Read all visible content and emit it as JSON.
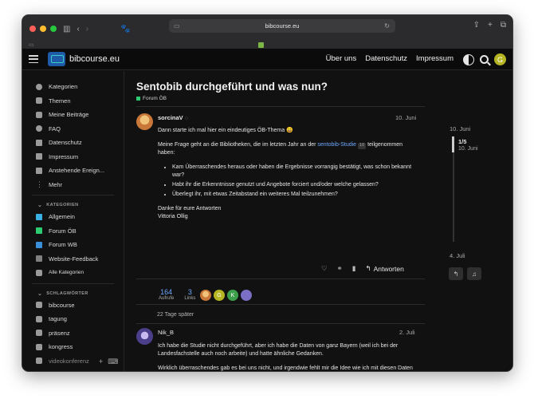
{
  "browser": {
    "url": "bibcourse.eu"
  },
  "site": {
    "name": "bibcourse.eu",
    "nav": [
      "Über uns",
      "Datenschutz",
      "Impressum"
    ],
    "user_initial": "G"
  },
  "sidebar": {
    "items": [
      "Kategorien",
      "Themen",
      "Meine Beiträge",
      "FAQ",
      "Datenschutz",
      "Impressum",
      "Anstehende Ereign...",
      "Mehr"
    ],
    "categories_header": "KATEGORIEN",
    "categories": [
      {
        "label": "Allgemein",
        "color": "#3ab0e2"
      },
      {
        "label": "Forum ÖB",
        "color": "#2ecc71"
      },
      {
        "label": "Forum WB",
        "color": "#3a8fd9"
      },
      {
        "label": "Website-Feedback",
        "color": "#808080"
      }
    ],
    "all_categories": "Alle Kategorien",
    "tags_header": "SCHLAGWÖRTER",
    "tags": [
      "bibcourse",
      "tagung",
      "präsenz",
      "kongress",
      "videokonferenz"
    ]
  },
  "topic": {
    "title": "Sentobib durchgeführt und was nun?",
    "category": "Forum ÖB"
  },
  "post1": {
    "author": "sorcinaV",
    "date": "10. Juni",
    "greeting": "Dann starte ich mal hier ein eindeutiges ÖB-Thema 😀",
    "para_a": "Meine Frage geht an die Bibliotheken, die im letzten Jahr an der ",
    "link": "sentobib-Studie",
    "link_count": "10",
    "para_b": " teilgenommen haben:",
    "bullets": [
      "Kam Überraschendes heraus oder haben die Ergebnisse vorrangig bestätigt, was schon bekannt war?",
      "Habt ihr die Erkenntnisse genutzt und Angebote forciert und/oder welche gelassen?",
      "Überlegt ihr, mit etwas Zeitabstand ein weiteres Mal teilzunehmen?"
    ],
    "thanks": "Danke für eure Antworten",
    "signature": "Vittoria Ollig",
    "reply_label": "Antworten",
    "views": "164",
    "views_label": "Aufrufe",
    "links": "3",
    "links_label": "Links",
    "participants": [
      "G",
      "K"
    ]
  },
  "gap": "22 Tage später",
  "post2": {
    "author": "Nik_B",
    "date": "2. Juli",
    "p1": "Ich habe die Studie nicht durchgeführt, aber ich habe die Daten von ganz Bayern (weil ich bei der Landesfachstelle auch noch arbeite) und hatte ähnliche Gedanken.",
    "p2": "Wirklich überraschendes gab es bei uns nicht, und irgendwie fehlt mir die Idee wie ich mit diesen Daten jetzt weiter mache (außer mal einen Insta Post damit zu machen)"
  },
  "timeline": {
    "start": "10. Juni",
    "count": "1/5",
    "current": "10. Juni",
    "end": "4. Juli"
  }
}
